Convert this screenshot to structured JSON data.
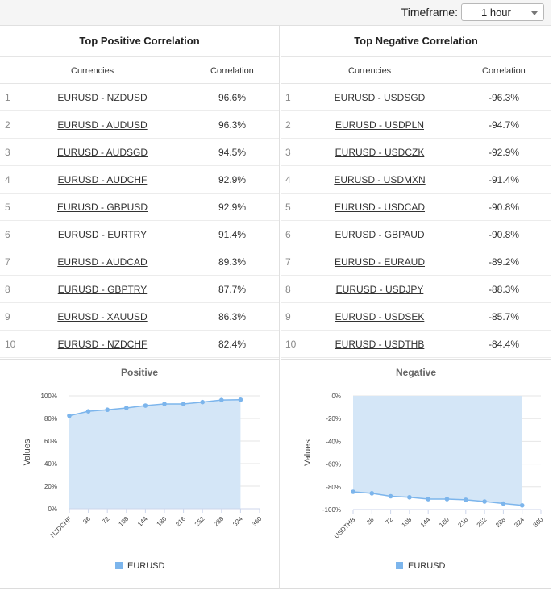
{
  "toolbar": {
    "timeframe_label": "Timeframe:",
    "timeframe_value": "1 hour"
  },
  "positive": {
    "title": "Top Positive Correlation",
    "col_currencies": "Currencies",
    "col_correlation": "Correlation",
    "rows": [
      {
        "rank": "1",
        "pair": "EURUSD - NZDUSD",
        "corr": "96.6%"
      },
      {
        "rank": "2",
        "pair": "EURUSD - AUDUSD",
        "corr": "96.3%"
      },
      {
        "rank": "3",
        "pair": "EURUSD - AUDSGD",
        "corr": "94.5%"
      },
      {
        "rank": "4",
        "pair": "EURUSD - AUDCHF",
        "corr": "92.9%"
      },
      {
        "rank": "5",
        "pair": "EURUSD - GBPUSD",
        "corr": "92.9%"
      },
      {
        "rank": "6",
        "pair": "EURUSD - EURTRY",
        "corr": "91.4%"
      },
      {
        "rank": "7",
        "pair": "EURUSD - AUDCAD",
        "corr": "89.3%"
      },
      {
        "rank": "8",
        "pair": "EURUSD - GBPTRY",
        "corr": "87.7%"
      },
      {
        "rank": "9",
        "pair": "EURUSD - XAUUSD",
        "corr": "86.3%"
      },
      {
        "rank": "10",
        "pair": "EURUSD - NZDCHF",
        "corr": "82.4%"
      }
    ]
  },
  "negative": {
    "title": "Top Negative Correlation",
    "col_currencies": "Currencies",
    "col_correlation": "Correlation",
    "rows": [
      {
        "rank": "1",
        "pair": "EURUSD - USDSGD",
        "corr": "-96.3%"
      },
      {
        "rank": "2",
        "pair": "EURUSD - USDPLN",
        "corr": "-94.7%"
      },
      {
        "rank": "3",
        "pair": "EURUSD - USDCZK",
        "corr": "-92.9%"
      },
      {
        "rank": "4",
        "pair": "EURUSD - USDMXN",
        "corr": "-91.4%"
      },
      {
        "rank": "5",
        "pair": "EURUSD - USDCAD",
        "corr": "-90.8%"
      },
      {
        "rank": "6",
        "pair": "EURUSD - GBPAUD",
        "corr": "-90.8%"
      },
      {
        "rank": "7",
        "pair": "EURUSD - EURAUD",
        "corr": "-89.2%"
      },
      {
        "rank": "8",
        "pair": "EURUSD - USDJPY",
        "corr": "-88.3%"
      },
      {
        "rank": "9",
        "pair": "EURUSD - USDSEK",
        "corr": "-85.7%"
      },
      {
        "rank": "10",
        "pair": "EURUSD - USDTHB",
        "corr": "-84.4%"
      }
    ]
  },
  "colors": {
    "series": "#7cb5ec",
    "fill": "#d4e6f7",
    "grid": "#e6e6e6"
  },
  "chart_data": [
    {
      "type": "area",
      "title": "Positive",
      "ylabel": "Values",
      "xlabel": "",
      "xlim": [
        0,
        360
      ],
      "ylim": [
        0,
        100
      ],
      "x_ticks": [
        "NZDCHF",
        "36",
        "72",
        "108",
        "144",
        "180",
        "216",
        "252",
        "288",
        "324",
        "360"
      ],
      "y_ticks": [
        "0%",
        "20%",
        "40%",
        "60%",
        "80%",
        "100%"
      ],
      "grid": true,
      "legend": "bottom",
      "series": [
        {
          "name": "EURUSD",
          "x": [
            0,
            36,
            72,
            108,
            144,
            180,
            216,
            252,
            288,
            324
          ],
          "values": [
            82.4,
            86.3,
            87.7,
            89.3,
            91.4,
            92.9,
            92.9,
            94.5,
            96.3,
            96.6
          ]
        }
      ]
    },
    {
      "type": "area",
      "title": "Negative",
      "ylabel": "Values",
      "xlabel": "",
      "xlim": [
        0,
        360
      ],
      "ylim": [
        -100,
        0
      ],
      "x_ticks": [
        "USDTHB",
        "36",
        "72",
        "108",
        "144",
        "180",
        "216",
        "252",
        "288",
        "324",
        "360"
      ],
      "y_ticks": [
        "0%",
        "-20%",
        "-40%",
        "-60%",
        "-80%",
        "-100%"
      ],
      "grid": true,
      "legend": "bottom",
      "series": [
        {
          "name": "EURUSD",
          "x": [
            0,
            36,
            72,
            108,
            144,
            180,
            216,
            252,
            288,
            324
          ],
          "values": [
            -84.4,
            -85.7,
            -88.3,
            -89.2,
            -90.8,
            -90.8,
            -91.4,
            -92.9,
            -94.7,
            -96.3
          ]
        }
      ]
    }
  ]
}
